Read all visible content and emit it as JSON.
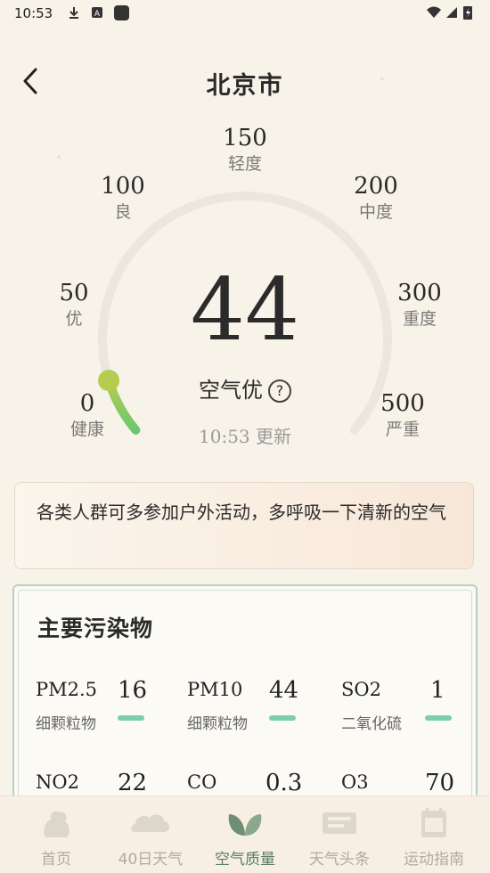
{
  "status_bar": {
    "time": "10:53"
  },
  "header": {
    "title": "北京市"
  },
  "aqi": {
    "value": "44",
    "level_fraction": 0.088,
    "description": "空气优",
    "updated": "10:53 更新",
    "scale": [
      {
        "value": "0",
        "label": "健康"
      },
      {
        "value": "50",
        "label": "优"
      },
      {
        "value": "100",
        "label": "良"
      },
      {
        "value": "150",
        "label": "轻度"
      },
      {
        "value": "200",
        "label": "中度"
      },
      {
        "value": "300",
        "label": "重度"
      },
      {
        "value": "500",
        "label": "严重"
      }
    ]
  },
  "advice": "各类人群可多参加户外活动，多呼吸一下清新的空气",
  "pollutants": {
    "title": "主要污染物",
    "items": [
      {
        "name": "PM2.5",
        "sub": "细颗粒物",
        "value": "16"
      },
      {
        "name": "PM10",
        "sub": "细颗粒物",
        "value": "44"
      },
      {
        "name": "SO2",
        "sub": "二氧化硫",
        "value": "1"
      },
      {
        "name": "NO2",
        "sub": "",
        "value": "22"
      },
      {
        "name": "CO",
        "sub": "",
        "value": "0.3"
      },
      {
        "name": "O3",
        "sub": "",
        "value": "70"
      }
    ]
  },
  "tabs": [
    {
      "label": "首页",
      "icon": "home-icon"
    },
    {
      "label": "40日天气",
      "icon": "cloud-icon"
    },
    {
      "label": "空气质量",
      "icon": "leaf-icon",
      "active": true
    },
    {
      "label": "天气头条",
      "icon": "scroll-icon"
    },
    {
      "label": "运动指南",
      "icon": "calendar-icon"
    }
  ],
  "colors": {
    "gauge_green": "#8fcf5a",
    "gauge_track": "#ece7dc",
    "bar": "#7ccfa8",
    "active_tab": "#5a7d64"
  }
}
